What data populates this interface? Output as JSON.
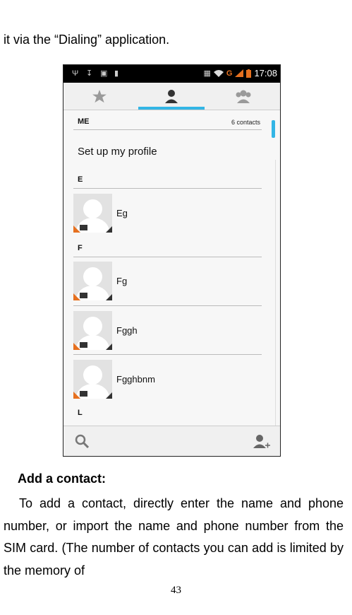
{
  "intro_text": "it via the “Dialing” application.",
  "phone": {
    "status_bar": {
      "time": "17:08",
      "network": "G"
    },
    "tabs": [
      {
        "icon": "star-icon",
        "selected": false
      },
      {
        "icon": "person-icon",
        "selected": true
      },
      {
        "icon": "group-icon",
        "selected": false
      }
    ],
    "me_section": {
      "header": "ME",
      "count": "6 contacts",
      "profile_label": "Set up my profile"
    },
    "sections": [
      {
        "letter": "E",
        "contacts": [
          "Eg"
        ]
      },
      {
        "letter": "F",
        "contacts": [
          "Fg",
          "Fggh",
          "Fgghbnm"
        ]
      },
      {
        "letter": "L",
        "contacts": []
      }
    ],
    "bottom_bar": {
      "left_icon": "search-icon",
      "right_icon": "add-contact-icon"
    },
    "accent_color": "#33b5e5"
  },
  "heading": "Add a contact:",
  "paragraph": "To add a contact, directly enter the name and phone number, or import the name and phone number from the SIM card. (The number of contacts you can add is limited by the memory of",
  "page_number": "43"
}
